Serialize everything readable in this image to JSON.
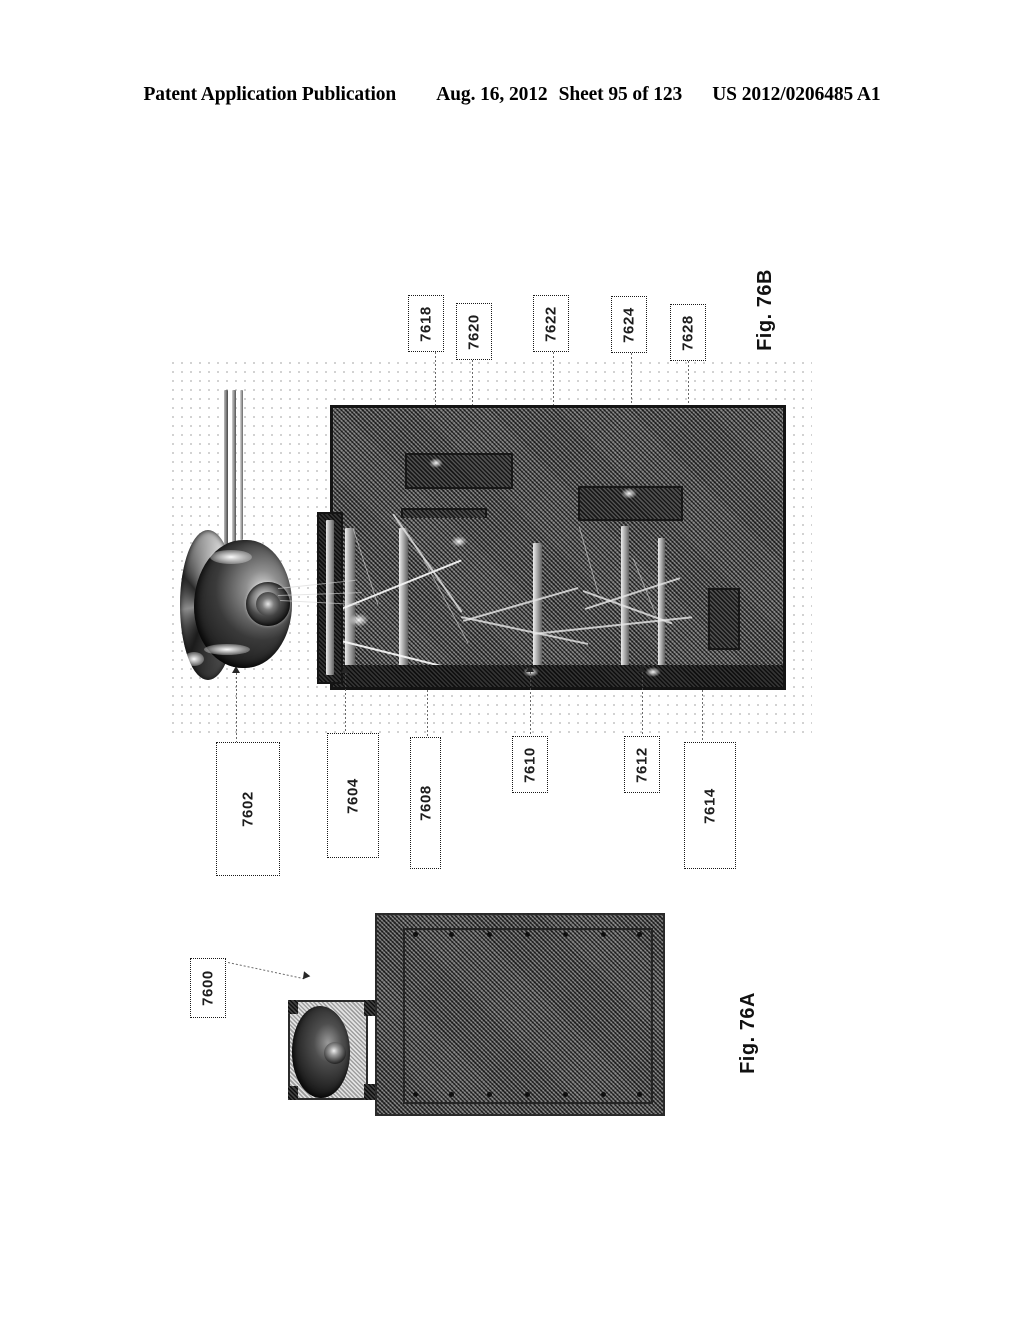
{
  "header": {
    "publication": "Patent Application Publication",
    "date": "Aug. 16, 2012",
    "sheet": "Sheet 95 of 123",
    "patent_number": "US 2012/0206485 A1"
  },
  "figures": [
    {
      "caption": "Fig. 76B",
      "id": "fig-76b",
      "description": "Interior view of electronic display enclosure with dome camera assembly",
      "top_callouts": [
        {
          "ref": "7618"
        },
        {
          "ref": "7620"
        },
        {
          "ref": "7622"
        },
        {
          "ref": "7624"
        },
        {
          "ref": "7628"
        }
      ],
      "bottom_callouts": [
        {
          "ref": "7602"
        },
        {
          "ref": "7604"
        },
        {
          "ref": "7608"
        },
        {
          "ref": "7610"
        },
        {
          "ref": "7612"
        },
        {
          "ref": "7614"
        }
      ]
    },
    {
      "caption": "Fig. 76A",
      "id": "fig-76a",
      "description": "Exterior perspective of display enclosure with attached camera module",
      "callouts": [
        {
          "ref": "7600"
        }
      ]
    }
  ],
  "colors": {
    "ink": "#000000",
    "enclosure": "#5d5d5d",
    "chassis_dark": "#1d1d1d",
    "panel_76a": "#585858",
    "module_76a": "#c9c9c9",
    "callout_border": "#1a1a1a",
    "paper": "#ffffff"
  }
}
